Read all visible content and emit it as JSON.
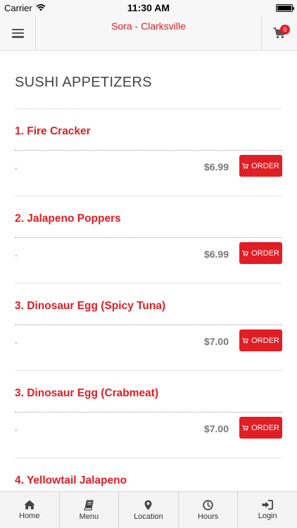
{
  "status_bar": {
    "carrier": "Carrier",
    "time": "11:30 AM"
  },
  "navbar": {
    "title": "Sora - Clarksville",
    "cart_count": "0"
  },
  "section": {
    "title": "SUSHI APPETIZERS"
  },
  "items": [
    {
      "name": "1. Fire Cracker",
      "desc": ".",
      "price": "$6.99",
      "order_label": "ORDER"
    },
    {
      "name": "2. Jalapeno Poppers",
      "desc": ".",
      "price": "$6.99",
      "order_label": "ORDER"
    },
    {
      "name": "3. Dinosaur Egg (Spicy Tuna)",
      "desc": ".",
      "price": "$7.00",
      "order_label": "ORDER"
    },
    {
      "name": "3. Dinosaur Egg (Crabmeat)",
      "desc": ".",
      "price": "$7.00",
      "order_label": "ORDER"
    },
    {
      "name": "4. Yellowtail Jalapeno",
      "desc": "",
      "price": "",
      "order_label": ""
    }
  ],
  "tabs": [
    {
      "label": "Home",
      "icon": "home-icon"
    },
    {
      "label": "Menu",
      "icon": "book-icon"
    },
    {
      "label": "Location",
      "icon": "map-marker-icon"
    },
    {
      "label": "Hours",
      "icon": "clock-icon"
    },
    {
      "label": "Login",
      "icon": "sign-in-icon"
    }
  ],
  "colors": {
    "accent": "#e01e25",
    "bar_bg": "#f7f7f7"
  }
}
